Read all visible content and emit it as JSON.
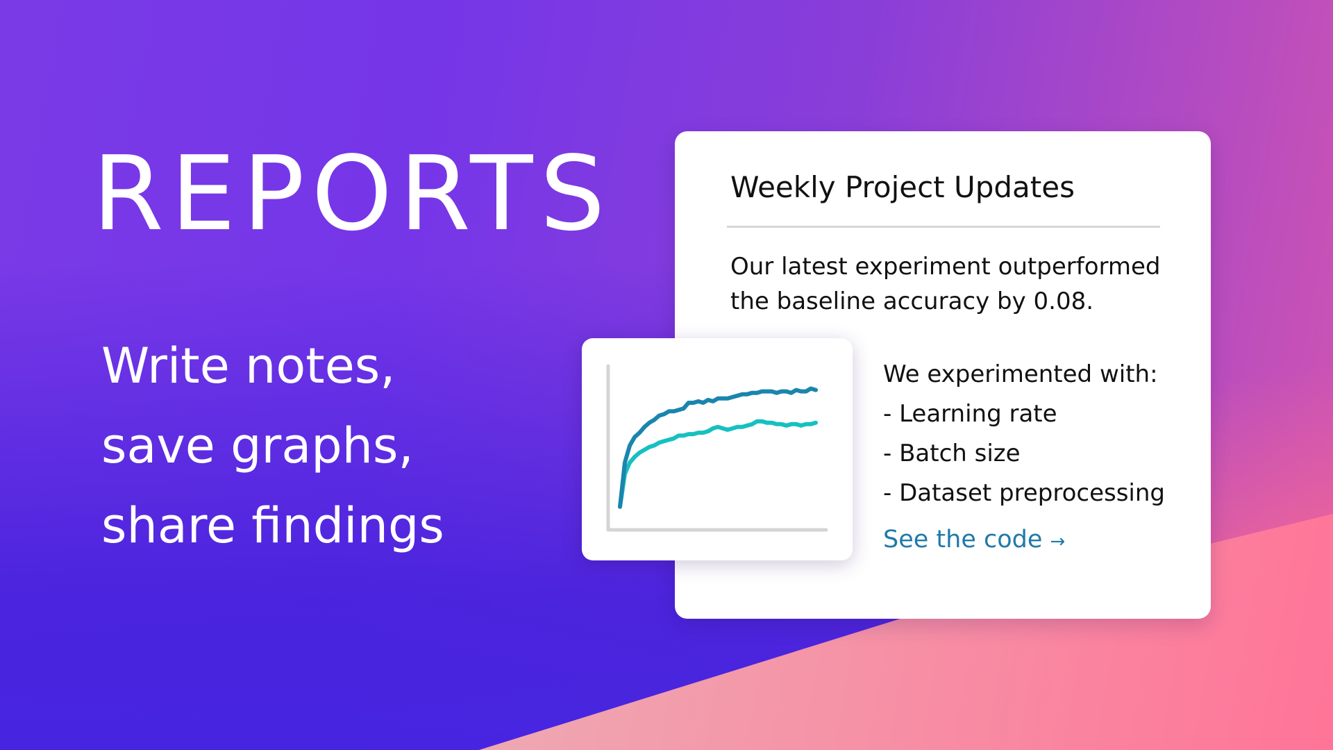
{
  "hero": {
    "title": "REPORTS",
    "tagline": [
      "Write notes,",
      "save graphs,",
      "share findings"
    ]
  },
  "report": {
    "title": "Weekly Project Updates",
    "summary": [
      "Our latest experiment outperformed",
      "the baseline accuracy by 0.08."
    ],
    "experiments_heading": "We experimented with:",
    "experiments": [
      "- Learning rate",
      "- Batch size",
      "- Dataset preprocessing"
    ],
    "code_link": "See the code",
    "code_link_arrow": "→"
  },
  "colors": {
    "link": "#1f7aa8",
    "series_dark": "#1a85ad",
    "series_light": "#17c0c0"
  },
  "chart_data": {
    "type": "line",
    "xlabel": "",
    "ylabel": "",
    "grid": false,
    "ylim": [
      0,
      1
    ],
    "x": [
      0,
      1,
      2,
      3,
      4,
      5,
      6,
      7,
      8,
      9,
      10,
      11,
      12,
      13,
      14,
      15,
      16,
      17,
      18,
      19,
      20,
      21,
      22,
      23,
      24,
      25,
      26,
      27,
      28,
      29,
      30,
      31,
      32,
      33,
      34,
      35,
      36,
      37,
      38,
      39,
      40
    ],
    "series": [
      {
        "color": "#1a85ad",
        "values": [
          0.07,
          0.38,
          0.5,
          0.56,
          0.59,
          0.63,
          0.66,
          0.68,
          0.71,
          0.72,
          0.74,
          0.74,
          0.75,
          0.76,
          0.8,
          0.8,
          0.81,
          0.8,
          0.82,
          0.81,
          0.83,
          0.83,
          0.83,
          0.84,
          0.85,
          0.86,
          0.86,
          0.87,
          0.87,
          0.88,
          0.88,
          0.88,
          0.87,
          0.88,
          0.88,
          0.87,
          0.89,
          0.88,
          0.88,
          0.9,
          0.89
        ]
      },
      {
        "color": "#17c0c0",
        "values": [
          0.07,
          0.3,
          0.38,
          0.42,
          0.45,
          0.47,
          0.49,
          0.5,
          0.52,
          0.53,
          0.54,
          0.55,
          0.57,
          0.57,
          0.58,
          0.58,
          0.59,
          0.59,
          0.6,
          0.62,
          0.63,
          0.62,
          0.61,
          0.62,
          0.63,
          0.63,
          0.64,
          0.65,
          0.67,
          0.67,
          0.66,
          0.66,
          0.65,
          0.65,
          0.64,
          0.65,
          0.65,
          0.64,
          0.65,
          0.65,
          0.66
        ]
      }
    ]
  }
}
